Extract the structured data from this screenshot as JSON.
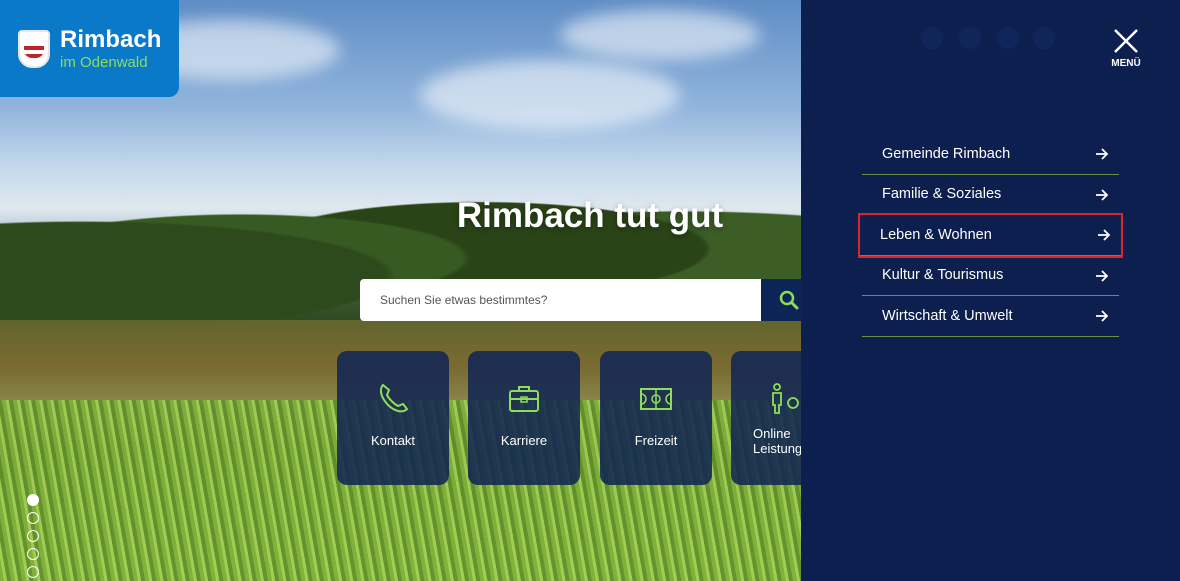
{
  "brand": {
    "title": "Rimbach",
    "subtitle": "im Odenwald"
  },
  "hero": {
    "headline": "Rimbach tut gut"
  },
  "search": {
    "placeholder": "Suchen Sie etwas bestimmtes?",
    "icon": "search-icon"
  },
  "tiles": [
    {
      "label": "Kontakt",
      "icon": "phone-icon"
    },
    {
      "label": "Karriere",
      "icon": "briefcase-icon"
    },
    {
      "label": "Freizeit",
      "icon": "court-icon"
    },
    {
      "label": "Online Leistung",
      "icon": "person-gear-icon"
    }
  ],
  "slider": {
    "count": 5,
    "active": 1
  },
  "menu": {
    "close_label": "MENÜ",
    "social": [
      "facebook-icon",
      "instagram-icon",
      "youtube-icon",
      "misc-icon"
    ],
    "items": [
      {
        "label": "Gemeinde Rimbach"
      },
      {
        "label": "Familie & Soziales"
      },
      {
        "label": "Leben & Wohnen"
      },
      {
        "label": "Kultur & Tourismus"
      },
      {
        "label": "Wirtschaft & Umwelt"
      }
    ]
  },
  "colors": {
    "menu_bg": "#0c1f4e",
    "logo_bg": "#0a79c8",
    "accent_green": "#8fdc5a",
    "highlight": "#e0232a"
  }
}
